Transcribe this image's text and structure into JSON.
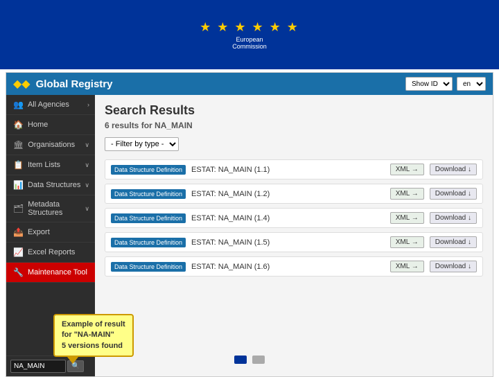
{
  "banner": {
    "stars": "★ ★ ★ ★ ★ ★",
    "line1": "European",
    "line2": "Commission"
  },
  "header": {
    "logo_symbol": "◆◆",
    "title": "Global Registry",
    "show_id_label": "Show ID",
    "lang_label": "en"
  },
  "sidebar": {
    "items": [
      {
        "id": "all-agencies",
        "icon": "👥",
        "label": "All Agencies",
        "arrow": "›"
      },
      {
        "id": "home",
        "icon": "🏠",
        "label": "Home",
        "arrow": ""
      },
      {
        "id": "organisations",
        "icon": "🏛",
        "label": "Organisations",
        "arrow": "∨"
      },
      {
        "id": "item-lists",
        "icon": "📋",
        "label": "Item Lists",
        "arrow": "∨"
      },
      {
        "id": "data-structures",
        "icon": "📊",
        "label": "Data Structures",
        "arrow": "∨"
      },
      {
        "id": "metadata-structures",
        "icon": "🗂",
        "label": "Metadata Structures",
        "arrow": "∨"
      },
      {
        "id": "export",
        "icon": "📤",
        "label": "Export",
        "arrow": ""
      },
      {
        "id": "excel-reports",
        "icon": "📈",
        "label": "Excel Reports",
        "arrow": ""
      },
      {
        "id": "maintenance-tool",
        "icon": "",
        "label": "Maintenance Tool",
        "arrow": "",
        "active": true
      }
    ],
    "search_placeholder": "NA_MAIN",
    "search_btn": "🔍"
  },
  "main": {
    "title": "Search Results",
    "subtitle_prefix": "6 results for",
    "subtitle_query": "NA_MAIN",
    "filter_label": "- Filter by type -",
    "results": [
      {
        "badge": "Data Structure Definition",
        "name": "ESTAT: NA_MAIN (1.1)",
        "xml_btn": "XML →",
        "dl_btn": "Download ↓"
      },
      {
        "badge": "Data Structure Definition",
        "name": "ESTAT: NA_MAIN (1.2)",
        "xml_btn": "XML →",
        "dl_btn": "Download ↓"
      },
      {
        "badge": "Data Structure Definition",
        "name": "ESTAT: NA_MAIN (1.4)",
        "xml_btn": "XML →",
        "dl_btn": "Download ↓"
      },
      {
        "badge": "Data Structure Definition",
        "name": "ESTAT: NA_MAIN (1.5)",
        "xml_btn": "XML →",
        "dl_btn": "Download ↓"
      },
      {
        "badge": "Data Structure Definition",
        "name": "ESTAT: NA_MAIN (1.6)",
        "xml_btn": "XML →",
        "dl_btn": "Download ↓"
      }
    ]
  },
  "callout": {
    "text": "Example of result\nfor \"NA-MAIN\"\n5 versions found"
  },
  "nav_dots": [
    {
      "active": true
    },
    {
      "active": false
    }
  ]
}
